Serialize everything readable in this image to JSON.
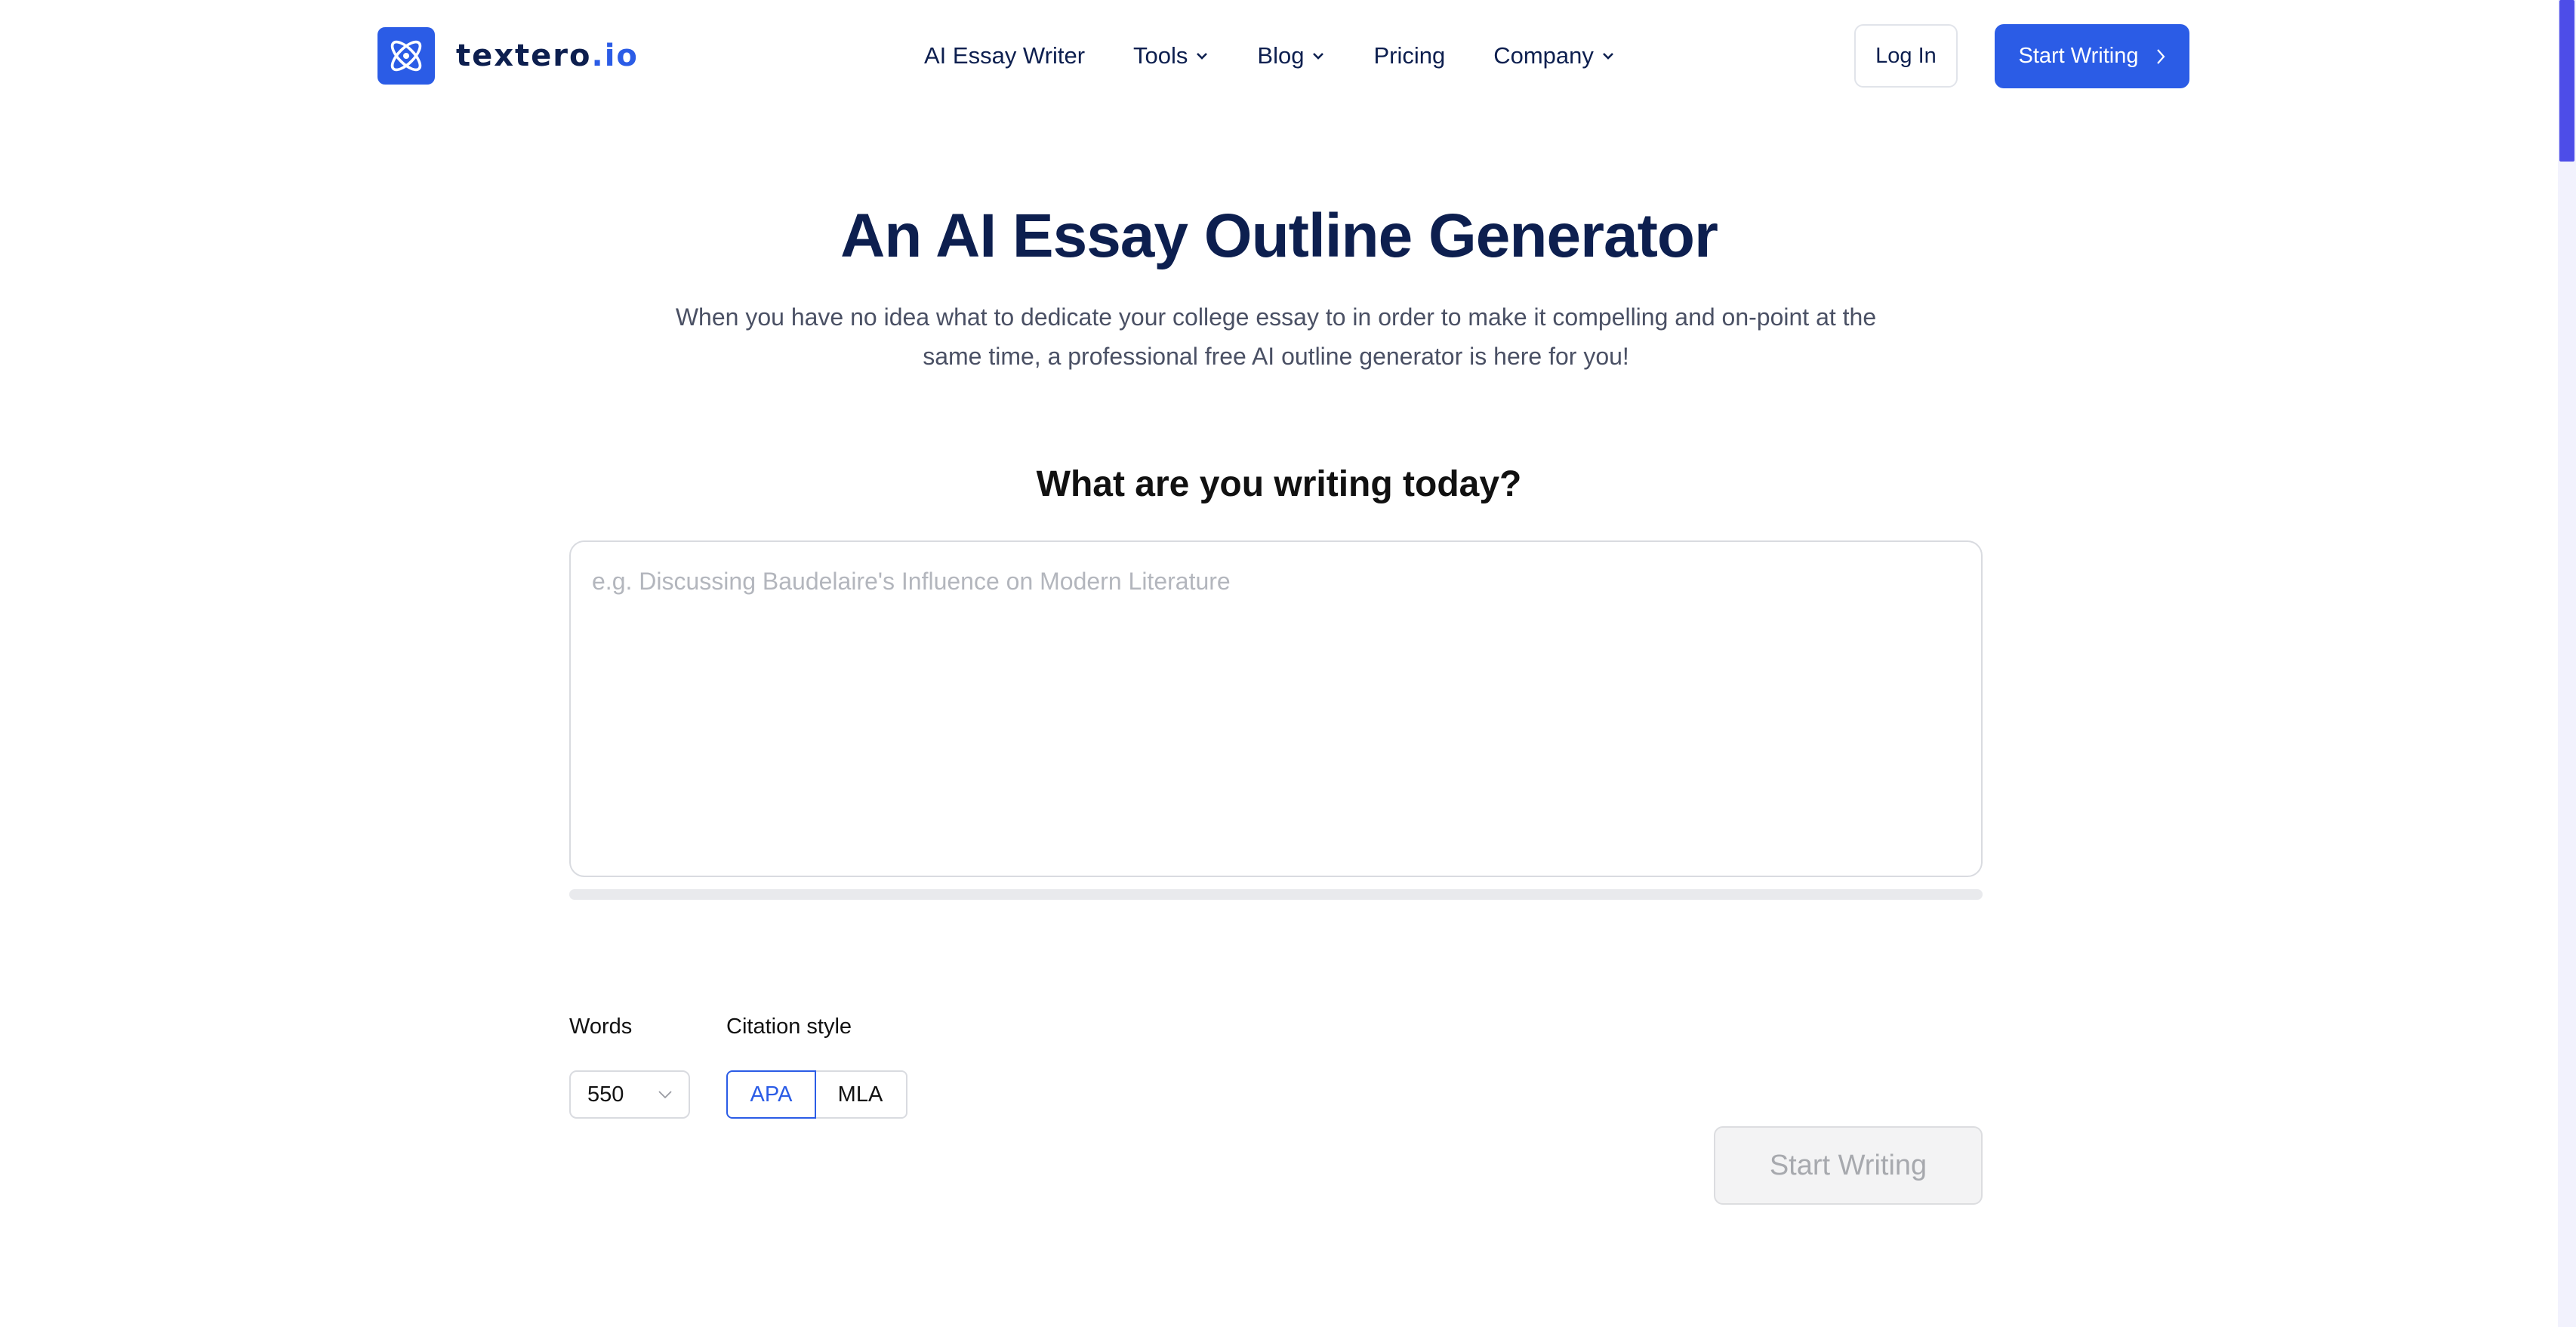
{
  "header": {
    "logo": {
      "name": "textero",
      "tld": ".io"
    },
    "nav": [
      {
        "label": "AI Essay Writer",
        "dropdown": false
      },
      {
        "label": "Tools",
        "dropdown": true
      },
      {
        "label": "Blog",
        "dropdown": true
      },
      {
        "label": "Pricing",
        "dropdown": false
      },
      {
        "label": "Company",
        "dropdown": true
      }
    ],
    "login_label": "Log In",
    "start_label": "Start Writing"
  },
  "hero": {
    "title": "An AI Essay Outline Generator",
    "subtitle": "When you have no idea what to dedicate your college essay to in order to make it compelling and on-point at the same time, a professional free AI outline generator is here for you!"
  },
  "form": {
    "prompt_title": "What are you writing today?",
    "topic_placeholder": "e.g. Discussing Baudelaire's Influence on Modern Literature",
    "topic_value": "",
    "progress_fraction": 0,
    "words_label": "Words",
    "words_value": "550",
    "citation_label": "Citation style",
    "citation_options": [
      "APA",
      "MLA"
    ],
    "citation_selected": "APA",
    "submit_label": "Start Writing"
  },
  "colors": {
    "accent": "#2b5ce6",
    "navy": "#0d1f4f",
    "scroll_thumb": "#4d4de8"
  },
  "icons": {
    "logo": "atom-icon",
    "dropdown": "chevron-down-icon",
    "start_arrow": "chevron-right-icon"
  }
}
